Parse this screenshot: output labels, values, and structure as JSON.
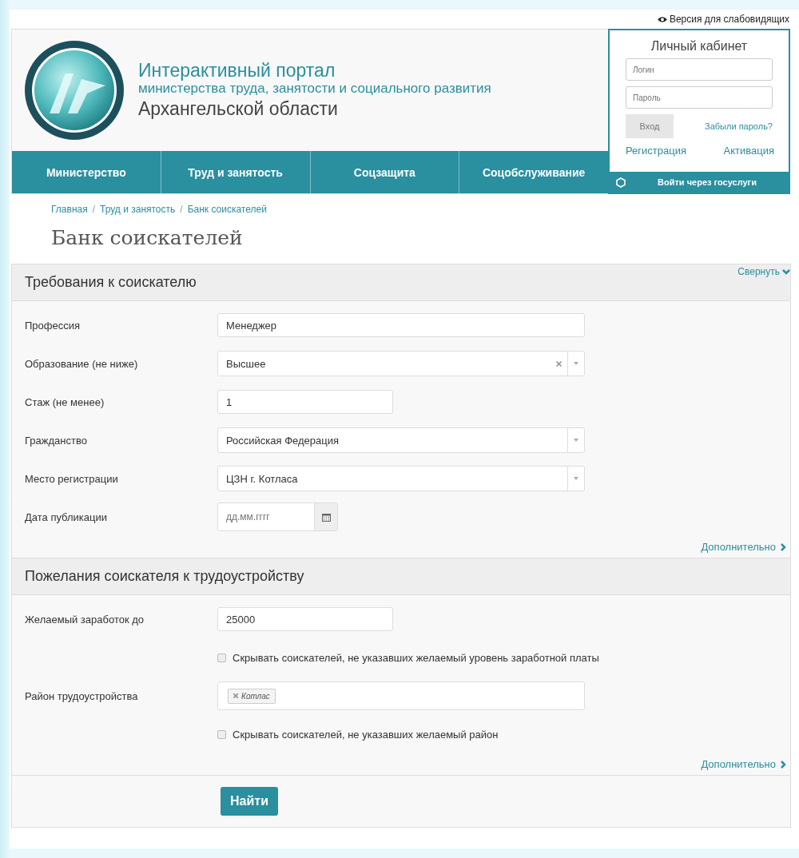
{
  "accessibility_link": {
    "label": "Версия для слабовидящих"
  },
  "header": {
    "title": "Интерактивный портал",
    "subtitle": "министерства труда, занятости и социального развития",
    "region": "Архангельской области"
  },
  "nav": [
    {
      "label": "Министерство"
    },
    {
      "label": "Труд и занятость"
    },
    {
      "label": "Соцзащита"
    },
    {
      "label": "Соцобслуживание"
    }
  ],
  "account": {
    "title": "Личный кабинет",
    "login_placeholder": "Логин",
    "password_placeholder": "Пароль",
    "login_button": "Вход",
    "forgot_link": "Забыли пароль?",
    "register_link": "Регистрация",
    "activate_link": "Активация",
    "gosuslugi_button": "Войти через госуслуги"
  },
  "breadcrumb_separator": "/",
  "breadcrumbs": [
    {
      "label": "Главная"
    },
    {
      "label": "Труд и занятость"
    },
    {
      "label": "Банк соискателей"
    }
  ],
  "page_title": "Банк соискателей",
  "collapse_link": "Свернуть",
  "sections": [
    {
      "title": "Требования к соискателю",
      "more_link": "Дополнительно",
      "fields": [
        {
          "kind": "text",
          "label": "Профессия",
          "value": "Менеджер"
        },
        {
          "kind": "select",
          "label": "Образование (не ниже)",
          "value": "Высшее",
          "clearable": true
        },
        {
          "kind": "short_text",
          "label": "Стаж (не менее)",
          "value": "1"
        },
        {
          "kind": "select",
          "label": "Гражданство",
          "value": "Российская Федерация",
          "clearable": false
        },
        {
          "kind": "select",
          "label": "Место регистрации",
          "value": "ЦЗН г. Котласа",
          "clearable": false
        },
        {
          "kind": "date",
          "label": "Дата публикации",
          "placeholder": "дд.мм.гггг"
        }
      ]
    },
    {
      "title": "Пожелания соискателя к трудоустройству",
      "more_link": "Дополнительно",
      "fields": [
        {
          "kind": "short_text",
          "label": "Желаемый заработок до",
          "value": "25000"
        },
        {
          "kind": "checkbox",
          "label": "Скрывать соискателей, не указавших желаемый уровень заработной платы",
          "checked": false
        },
        {
          "kind": "tags",
          "label": "Район трудоустройства",
          "tags": [
            "Котлас"
          ]
        },
        {
          "kind": "checkbox",
          "label": "Скрывать соискателей, не указавших желаемый район",
          "checked": false
        }
      ]
    }
  ],
  "search_button": "Найти"
}
